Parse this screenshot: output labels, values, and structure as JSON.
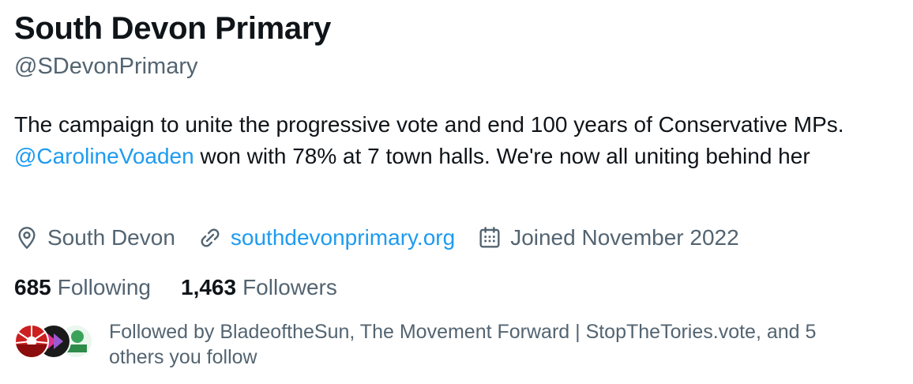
{
  "profile": {
    "display_name": "South Devon Primary",
    "handle": "@SDevonPrimary",
    "bio": {
      "part1": "The campaign to unite the progressive vote and end 100 years of Conservative MPs. ",
      "mention": "@CarolineVoaden",
      "part2": " won with 78% at 7 town halls. We're now all uniting behind her"
    },
    "location": "South Devon",
    "website": "southdevonprimary.org",
    "joined": "Joined November 2022",
    "following_count": "685",
    "following_label": "Following",
    "followers_count": "1,463",
    "followers_label": "Followers",
    "followed_by": "Followed by BladeoftheSun, The Movement Forward | StopTheTories.vote, and 5 others you follow"
  },
  "icons": {
    "location": "location-pin-icon",
    "website": "link-icon",
    "joined": "calendar-icon"
  },
  "colors": {
    "text_primary": "#0f1419",
    "text_secondary": "#536471",
    "link": "#1d9bf0",
    "background": "#ffffff"
  }
}
